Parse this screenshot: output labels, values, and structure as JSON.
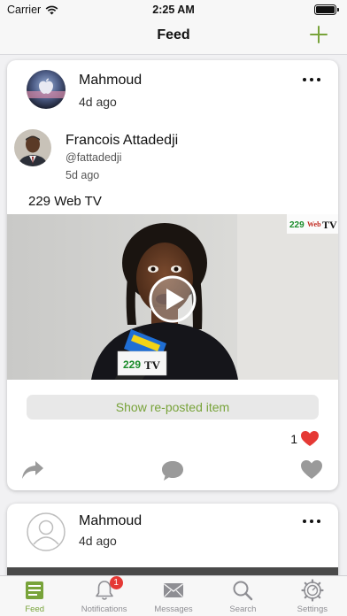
{
  "status_bar": {
    "carrier": "Carrier",
    "time": "2:25 AM"
  },
  "nav": {
    "title": "Feed",
    "add_icon": "plus-icon"
  },
  "colors": {
    "accent": "#78a33a",
    "heart": "#e53935",
    "badge": "#e53935"
  },
  "posts": [
    {
      "author": "Mahmoud",
      "time": "4d ago",
      "reposted": {
        "name": "Francois Attadedji",
        "handle": "@fattadedji",
        "time": "5d ago",
        "text": "229 Web TV",
        "video_logo": "229 Web TV"
      },
      "show_repost_label": "Show re-posted item",
      "likes": "1"
    },
    {
      "author": "Mahmoud",
      "time": "4d ago"
    }
  ],
  "tabs": [
    {
      "label": "Feed",
      "icon": "feed-icon"
    },
    {
      "label": "Notifications",
      "icon": "bell-icon",
      "badge": "1"
    },
    {
      "label": "Messages",
      "icon": "envelope-icon"
    },
    {
      "label": "Search",
      "icon": "search-icon"
    },
    {
      "label": "Settings",
      "icon": "gear-icon"
    }
  ]
}
